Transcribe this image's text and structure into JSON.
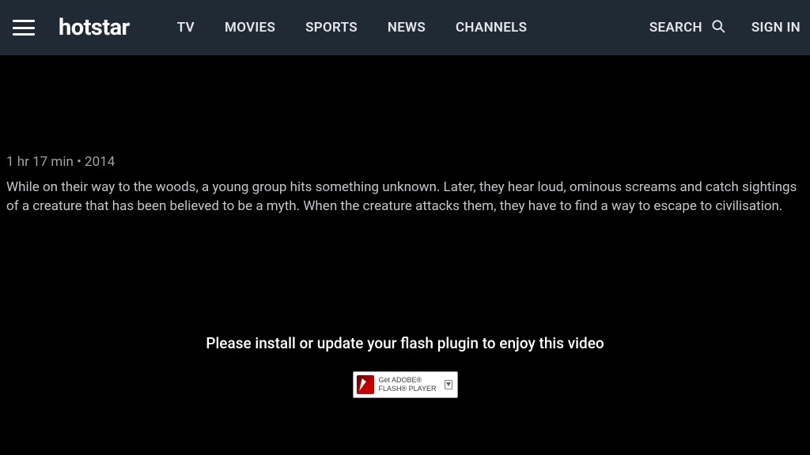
{
  "header": {
    "logo": "hotstar",
    "nav": {
      "tv": "TV",
      "movies": "MOVIES",
      "sports": "SPORTS",
      "news": "NEWS",
      "channels": "CHANNELS"
    },
    "search_label": "SEARCH",
    "signin": "SIGN IN"
  },
  "detail": {
    "meta": "1 hr 17 min • 2014",
    "description": "While on their way to the woods, a young group hits something unknown. Later, they hear loud, ominous screams and catch sightings of a creature that has been believed to be a myth. When the creature attacks them, they have to find a way to escape to civilisation."
  },
  "player": {
    "flash_message": "Please install or update your flash plugin to enjoy this video",
    "flash_button_line1": "Get ADOBE®",
    "flash_button_line2": "FLASH® PLAYER"
  }
}
